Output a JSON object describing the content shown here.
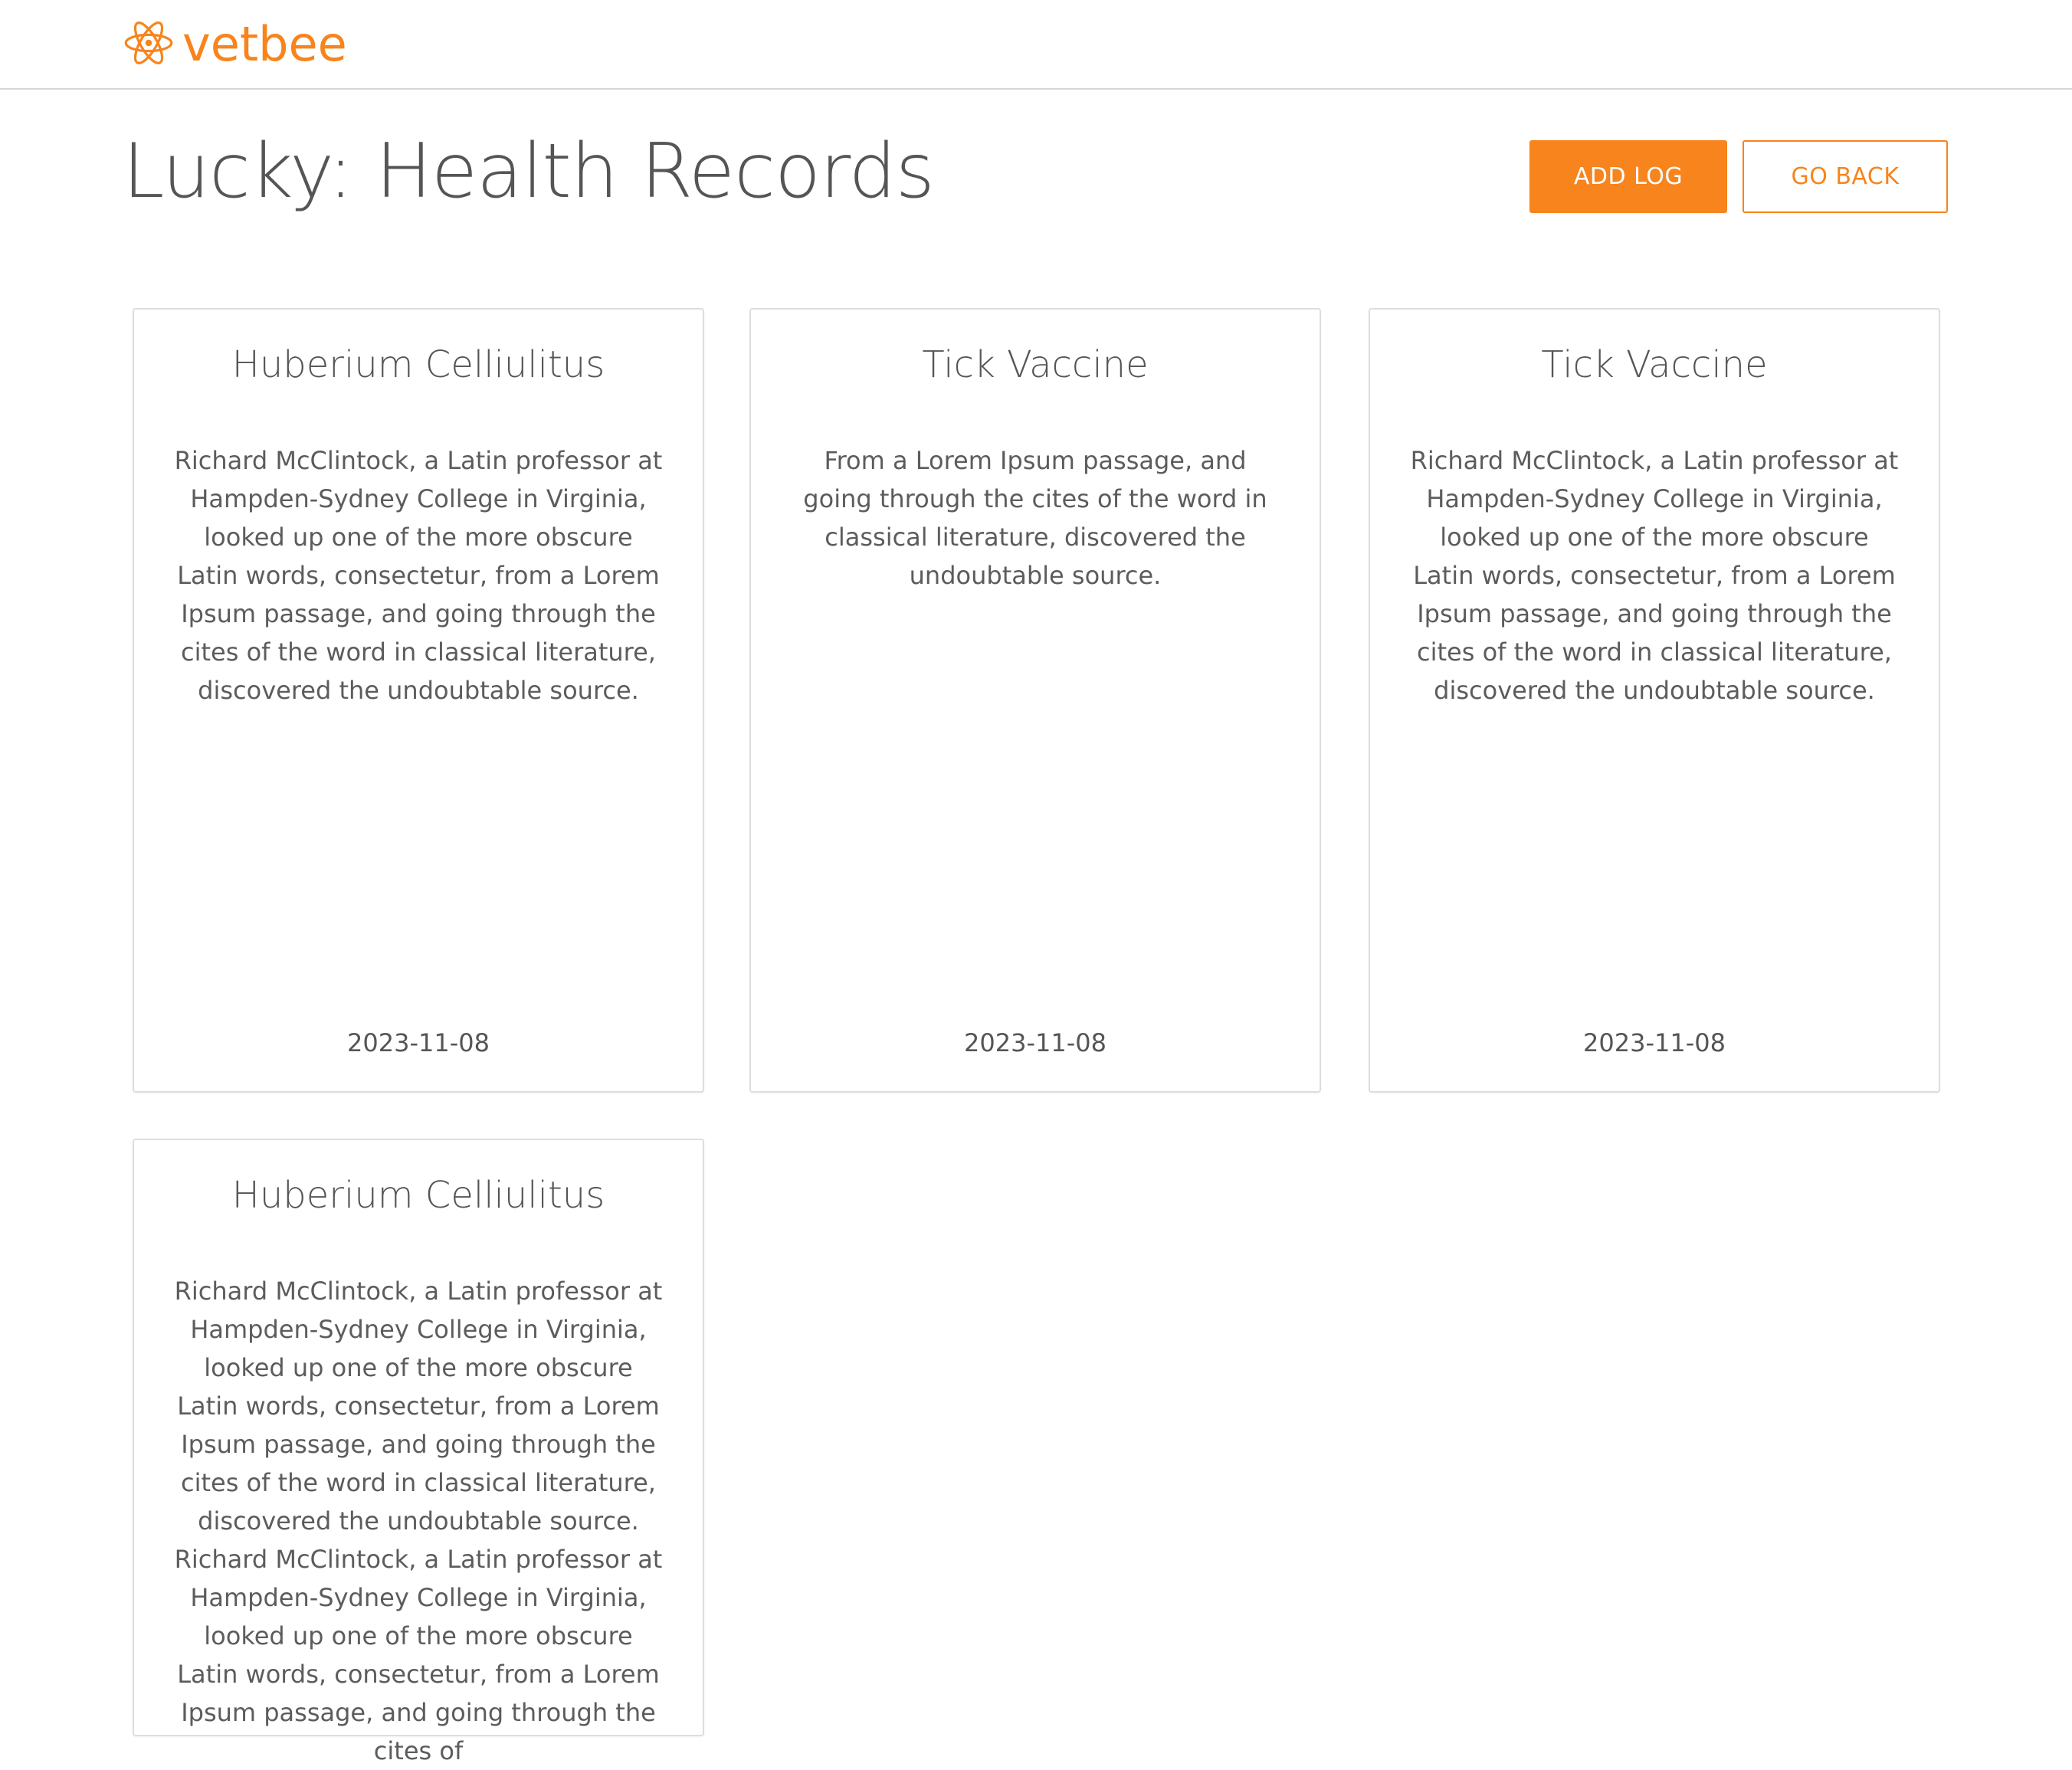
{
  "brand": {
    "name": "vetbee",
    "icon": "atom-paw-icon",
    "accent": "#f7841d"
  },
  "page": {
    "title": "Lucky: Health Records"
  },
  "actions": {
    "add_log": "ADD LOG",
    "go_back": "GO BACK"
  },
  "records": [
    {
      "title": "Huberium Celliulitus",
      "description": "Richard McClintock, a Latin professor at Hampden-Sydney College in Virginia, looked up one of the more obscure Latin words, consectetur, from a Lorem Ipsum passage, and going through the cites of the word in classical literature, discovered the undoubtable source.",
      "date": "2023-11-08"
    },
    {
      "title": "Tick Vaccine",
      "description": "From a Lorem Ipsum passage, and going through the cites of the word in classical literature, discovered the undoubtable source.",
      "date": "2023-11-08"
    },
    {
      "title": "Tick Vaccine",
      "description": "Richard McClintock, a Latin professor at Hampden-Sydney College in Virginia, looked up one of the more obscure Latin words, consectetur, from a Lorem Ipsum passage, and going through the cites of the word in classical literature, discovered the undoubtable source.",
      "date": "2023-11-08"
    },
    {
      "title": "Huberium Celliulitus",
      "description": "Richard McClintock, a Latin professor at Hampden-Sydney College in Virginia, looked up one of the more obscure Latin words, consectetur, from a Lorem Ipsum passage, and going through the cites of the word in classical literature, discovered the undoubtable source. Richard McClintock, a Latin professor at Hampden-Sydney College in Virginia, looked up one of the more obscure Latin words, consectetur, from a Lorem Ipsum passage, and going through the cites of"
    }
  ]
}
